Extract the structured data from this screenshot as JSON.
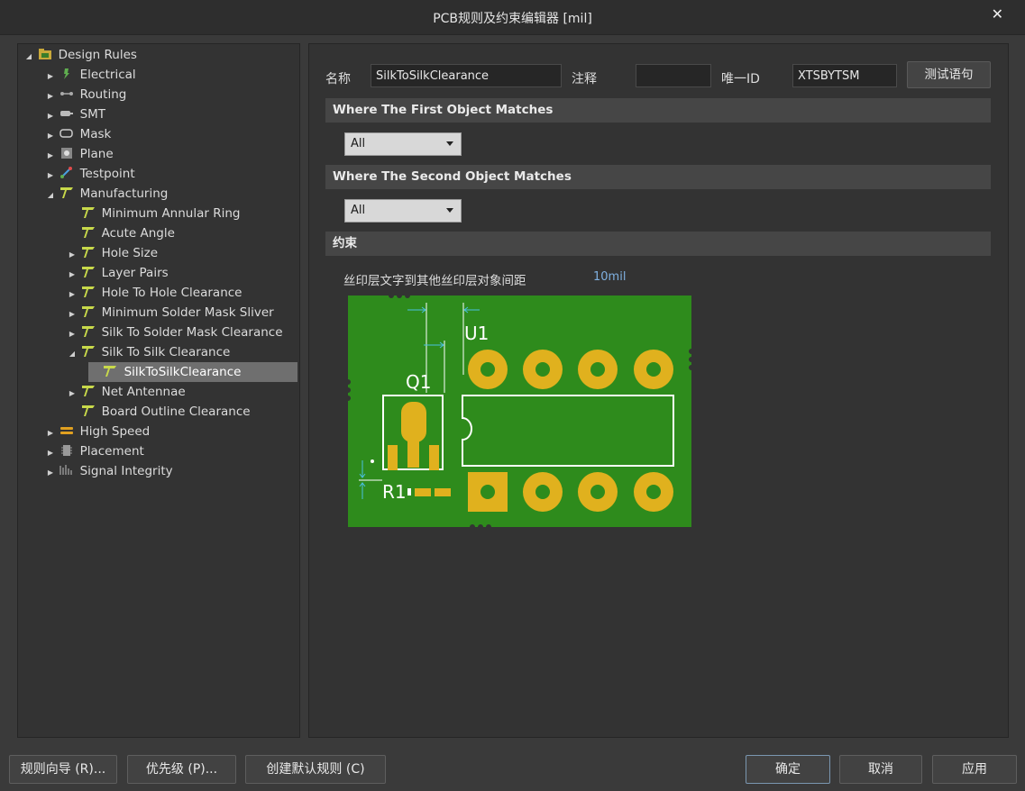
{
  "window": {
    "title": "PCB规则及约束编辑器 [mil]",
    "close": "✕"
  },
  "tree": {
    "root": "Design Rules",
    "items": [
      {
        "label": "Electrical"
      },
      {
        "label": "Routing"
      },
      {
        "label": "SMT"
      },
      {
        "label": "Mask"
      },
      {
        "label": "Plane"
      },
      {
        "label": "Testpoint"
      },
      {
        "label": "Manufacturing"
      },
      {
        "label": "Minimum Annular Ring"
      },
      {
        "label": "Acute Angle"
      },
      {
        "label": "Hole Size"
      },
      {
        "label": "Layer Pairs"
      },
      {
        "label": "Hole To Hole Clearance"
      },
      {
        "label": "Minimum Solder Mask Sliver"
      },
      {
        "label": "Silk To Solder Mask Clearance"
      },
      {
        "label": "Silk To Silk Clearance"
      },
      {
        "label": "SilkToSilkClearance"
      },
      {
        "label": "Net Antennae"
      },
      {
        "label": "Board Outline Clearance"
      },
      {
        "label": "High Speed"
      },
      {
        "label": "Placement"
      },
      {
        "label": "Signal Integrity"
      }
    ]
  },
  "rule": {
    "name_label": "名称",
    "name_value": "SilkToSilkClearance",
    "comment_label": "注释",
    "comment_value": "",
    "uid_label": "唯一ID",
    "uid_value": "XTSBYTSM",
    "test_button": "测试语句"
  },
  "first_match": {
    "heading": "Where The First Object Matches",
    "selected": "All"
  },
  "second_match": {
    "heading": "Where The Second Object Matches",
    "selected": "All"
  },
  "constraints": {
    "heading": "约束",
    "clearance_label": "丝印层文字到其他丝印层对象间距",
    "clearance_value": "10mil"
  },
  "diagram": {
    "label_u1": "U1",
    "label_q1": "Q1",
    "label_r1": "R1"
  },
  "footer": {
    "wizard": "规则向导 (R)...",
    "priority": "优先级 (P)...",
    "defaults": "创建默认规则 (C)",
    "ok": "确定",
    "cancel": "取消",
    "apply": "应用"
  },
  "colors": {
    "board": "#2e8b1c",
    "pad": "#e0b11e",
    "silk": "#ffffff",
    "selection": "#6f6f6f"
  }
}
